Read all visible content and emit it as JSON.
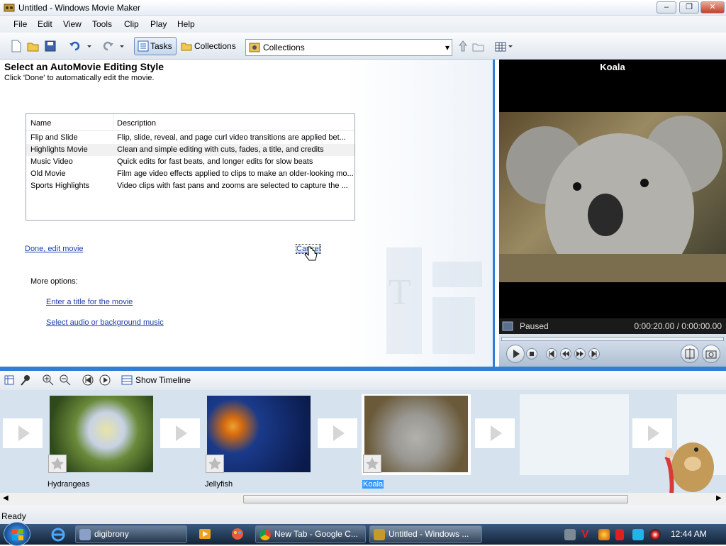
{
  "window": {
    "title": "Untitled - Windows Movie Maker"
  },
  "menu": [
    "File",
    "Edit",
    "View",
    "Tools",
    "Clip",
    "Play",
    "Help"
  ],
  "toolbar": {
    "tasks": "Tasks",
    "collections": "Collections",
    "collection_select": "Collections"
  },
  "taskpane": {
    "heading": "Select an AutoMovie Editing Style",
    "instruction": "Click 'Done' to automatically edit the movie.",
    "columns": [
      "Name",
      "Description"
    ],
    "styles": [
      {
        "name": "Flip and Slide",
        "description": "Flip, slide, reveal, and page curl video transitions are applied bet..."
      },
      {
        "name": "Highlights Movie",
        "description": "Clean and simple editing with cuts, fades, a title, and credits"
      },
      {
        "name": "Music Video",
        "description": "Quick edits for fast beats, and longer edits for slow beats"
      },
      {
        "name": "Old Movie",
        "description": "Film age video effects applied to clips to make an older-looking mo..."
      },
      {
        "name": "Sports Highlights",
        "description": "Video clips with fast pans and zooms are selected to capture the ..."
      }
    ],
    "done_link": "Done, edit movie",
    "cancel_link": "Cancel",
    "more_options": "More options:",
    "title_link": "Enter a title for the movie",
    "music_link": "Select audio or background music"
  },
  "preview": {
    "title": "Koala",
    "status": "Paused",
    "time": "0:00:20.00 / 0:00:00.00"
  },
  "storyboard": {
    "show_timeline": "Show Timeline",
    "clips": [
      {
        "label": "Hydrangeas"
      },
      {
        "label": "Jellyfish"
      },
      {
        "label": "Koala"
      }
    ]
  },
  "status": {
    "text": "Ready"
  },
  "taskbar": {
    "items": [
      "digibrony",
      "New Tab - Google C...",
      "Untitled - Windows ..."
    ],
    "clock": "12:44 AM"
  },
  "colors": {
    "accent": "#2f7fd6",
    "link": "#1f3fa8",
    "selection": "#3399ff"
  }
}
